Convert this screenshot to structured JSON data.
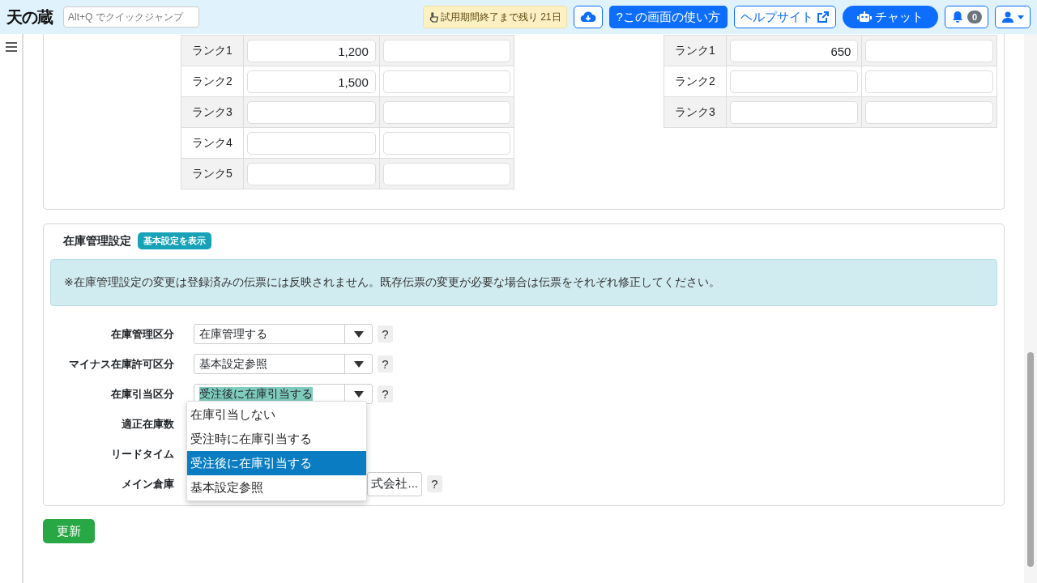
{
  "header": {
    "logo": "天の蔵",
    "search": {
      "placeholder": "Alt+Q でクイックジャンプ"
    },
    "trial_badge": "試用期間終了まで残り 21日",
    "help_button": "?この画面の使い方",
    "help_site_link": "ヘルプサイト",
    "chat_button": "チャット",
    "notification_count": "0"
  },
  "price_tables": [
    {
      "rows": [
        {
          "label": "ランク1",
          "value": "1,200"
        },
        {
          "label": "ランク2",
          "value": "1,500"
        },
        {
          "label": "ランク3"
        },
        {
          "label": "ランク4"
        },
        {
          "label": "ランク5"
        }
      ]
    },
    {
      "rows": [
        {
          "label": "ランク1",
          "value": "650"
        },
        {
          "label": "ランク2"
        },
        {
          "label": "ランク3"
        }
      ]
    }
  ],
  "stock_settings": {
    "title": "在庫管理設定",
    "badge": "基本設定を表示",
    "notice": "※在庫管理設定の変更は登録済みの伝票には反映されません。既存伝票の変更が必要な場合は伝票をそれぞれ修正してください。",
    "fields": [
      {
        "label": "在庫管理区分",
        "kind": "select",
        "value": "在庫管理する",
        "highlighted": false,
        "help": "?"
      },
      {
        "label": "マイナス在庫許可区分",
        "kind": "select",
        "value": "基本設定参照",
        "highlighted": false,
        "help": "?"
      },
      {
        "label": "在庫引当区分",
        "kind": "select",
        "value": "受注後に在庫引当する",
        "highlighted": true,
        "help": "?",
        "options": [
          {
            "label": "在庫引当しない",
            "selected": false
          },
          {
            "label": "受注時に在庫引当する",
            "selected": false
          },
          {
            "label": "受注後に在庫引当する",
            "selected": true
          },
          {
            "label": "基本設定参照",
            "selected": false
          }
        ]
      },
      {
        "label": "適正在庫数",
        "kind": "hidden"
      },
      {
        "label": "リードタイム",
        "kind": "hidden"
      },
      {
        "label": "メイン倉庫",
        "kind": "text",
        "value": "式会社...",
        "help": "?"
      }
    ]
  },
  "update_button": "更新"
}
